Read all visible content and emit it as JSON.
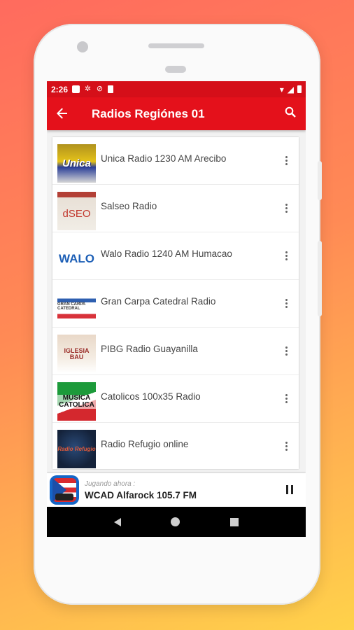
{
  "status_bar": {
    "time": "2:26"
  },
  "toolbar": {
    "title": "Radios Regiónes 01",
    "back_icon": "arrow-left-icon",
    "search_icon": "search-icon"
  },
  "stations": [
    {
      "name": "Unica Radio 1230 AM Arecibo",
      "logo_text": "Unica"
    },
    {
      "name": "Salseo Radio",
      "logo_text": "dSEO"
    },
    {
      "name": "Walo Radio 1240 AM Humacao",
      "logo_text": "WALO"
    },
    {
      "name": "Gran Carpa Catedral Radio",
      "logo_text": "GRAN CARPA CATEDRAL"
    },
    {
      "name": "PIBG Radio Guayanilla",
      "logo_text": "IGLESIA BAU"
    },
    {
      "name": "Catolicos 100x35 Radio",
      "logo_text": "MUSICA CATOLICA"
    },
    {
      "name": "Radio Refugio online",
      "logo_text": "Radio Refugio"
    }
  ],
  "player": {
    "label": "Jugando ahora :",
    "title": "WCAD Alfarock 105.7 FM"
  },
  "colors": {
    "primary": "#e4111b",
    "status_bar": "#d50f19",
    "navbar": "#000000"
  }
}
